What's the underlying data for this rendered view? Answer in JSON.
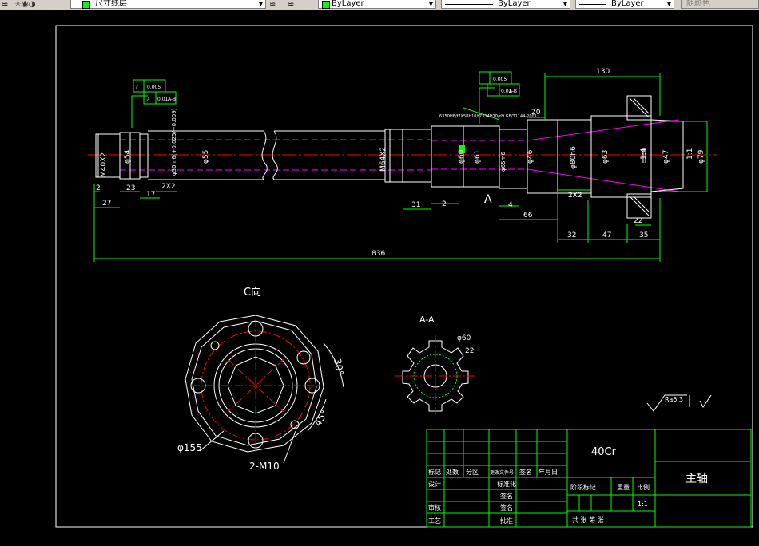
{
  "toolbar": {
    "layer_name": "尺寸线层",
    "color_value": "ByLayer",
    "linetype_value": "ByLayer",
    "lineweight_value": "ByLayer",
    "plotstyle_value": "随颜色"
  },
  "drawing": {
    "dims_top": {
      "overall_length": "836",
      "right_length": "130",
      "d20": "20",
      "d66": "66",
      "d4": "4",
      "d32": "32",
      "d47": "47",
      "d35": "35",
      "d22": "22",
      "d2x2_right": "2X2",
      "d31": "31",
      "d2_mid": "2",
      "d27": "27",
      "d2_left": "2",
      "d23": "23",
      "d17": "17",
      "d2x2_left": "2X2"
    },
    "dims_vertical": {
      "m40": "M40X2",
      "phi54": "φ54",
      "phi50": "φ50m6(+0.025/+0.009)",
      "phi55": "φ55",
      "m64": "M64X2",
      "phi60": "φ60",
      "phi61": "φ61",
      "phi65": "φ65m6",
      "phi46": "φ46",
      "phi80": "φ80h6",
      "phi63": "φ63",
      "one_to_four": "1:4",
      "phi47": "φ47",
      "phi79": "φ79",
      "tol1": "1:1"
    },
    "tolerance_left": {
      "sym1": "⫽",
      "val1": "0.005",
      "sym2": "↗",
      "val2": "0.01",
      "ref": "A-B"
    },
    "tolerance_right": {
      "val1": "0.005",
      "val2": "0.01",
      "ref": "A-B"
    },
    "section_label_A": "A",
    "spline_note": "6X50H8/f7X58H10/f7X14H10/d9 GB/T1144-2001",
    "view_c_title": "C向",
    "flange_dia": "φ155",
    "flange_holes": "2-M10",
    "angle_30": "30°",
    "angle_45": "45°",
    "section_aa_title": "A-A",
    "section_phi60": "φ60",
    "section_22": "22",
    "roughness_main": "Ra6.3",
    "roughness_check": "√"
  },
  "title_block": {
    "material": "40Cr",
    "part_name": "主轴",
    "row_labels_1": [
      "标记",
      "处数",
      "分区",
      "更改文件号",
      "签名",
      "年月日"
    ],
    "design": "设计",
    "standardize": "标准化",
    "review": "审核",
    "process": "工艺",
    "sign": "签名",
    "approve": "批准",
    "stage_mark": "阶段标记",
    "weight": "重量",
    "scale": "比例",
    "scale_value": "1:1",
    "sheets": "共 张 第 张"
  }
}
